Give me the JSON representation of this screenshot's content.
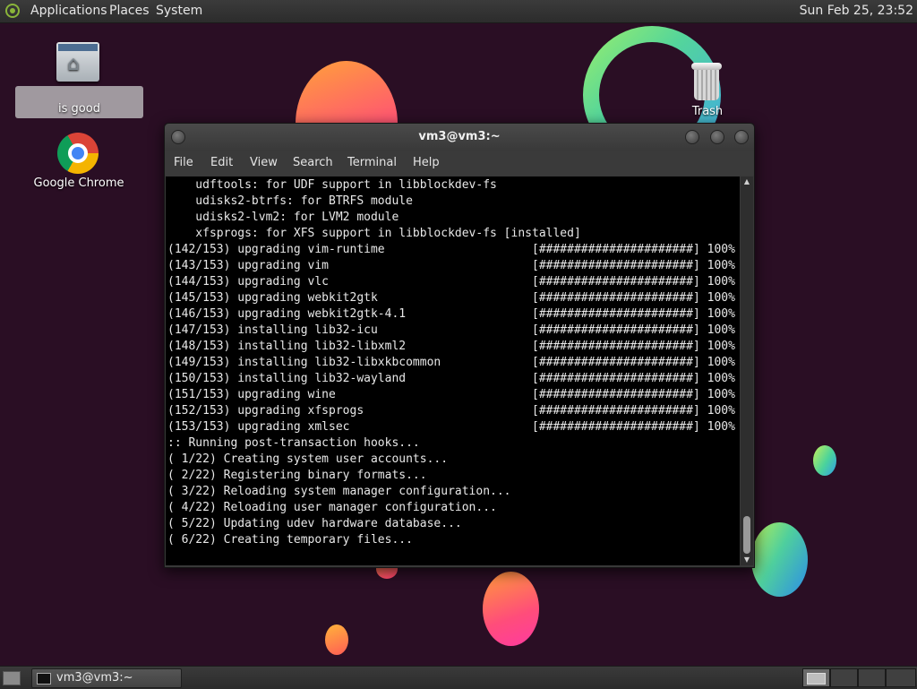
{
  "top_panel": {
    "menus": {
      "applications": "Applications",
      "places": "Places",
      "system": "System"
    },
    "clock": "Sun Feb 25, 23:52"
  },
  "desktop": {
    "icons": {
      "home": {
        "label": "is good",
        "icon": "home-folder-icon"
      },
      "chrome": {
        "label": "Google Chrome",
        "icon": "chrome-icon"
      },
      "trash": {
        "label": "Trash",
        "icon": "trash-icon"
      }
    }
  },
  "terminal": {
    "title": "vm3@vm3:~",
    "menu": {
      "file": "File",
      "edit": "Edit",
      "view": "View",
      "search": "Search",
      "terminal": "Terminal",
      "help": "Help"
    },
    "output": "    udftools: for UDF support in libblockdev-fs\n    udisks2-btrfs: for BTRFS module\n    udisks2-lvm2: for LVM2 module\n    xfsprogs: for XFS support in libblockdev-fs [installed]\n(142/153) upgrading vim-runtime                     [######################] 100%\n(143/153) upgrading vim                             [######################] 100%\n(144/153) upgrading vlc                             [######################] 100%\n(145/153) upgrading webkit2gtk                      [######################] 100%\n(146/153) upgrading webkit2gtk-4.1                  [######################] 100%\n(147/153) installing lib32-icu                      [######################] 100%\n(148/153) installing lib32-libxml2                  [######################] 100%\n(149/153) installing lib32-libxkbcommon             [######################] 100%\n(150/153) installing lib32-wayland                  [######################] 100%\n(151/153) upgrading wine                            [######################] 100%\n(152/153) upgrading xfsprogs                        [######################] 100%\n(153/153) upgrading xmlsec                          [######################] 100%\n:: Running post-transaction hooks...\n( 1/22) Creating system user accounts...\n( 2/22) Registering binary formats...\n( 3/22) Reloading system manager configuration...\n( 4/22) Reloading user manager configuration...\n( 5/22) Updating udev hardware database...\n( 6/22) Creating temporary files..."
  },
  "taskbar": {
    "window_button": "vm3@vm3:~"
  },
  "colors": {
    "desktop_bg": "#2a0e24",
    "panel_bg": "#2c2c2c",
    "terminal_bg": "#000000",
    "terminal_fg": "#e8e8e8"
  }
}
